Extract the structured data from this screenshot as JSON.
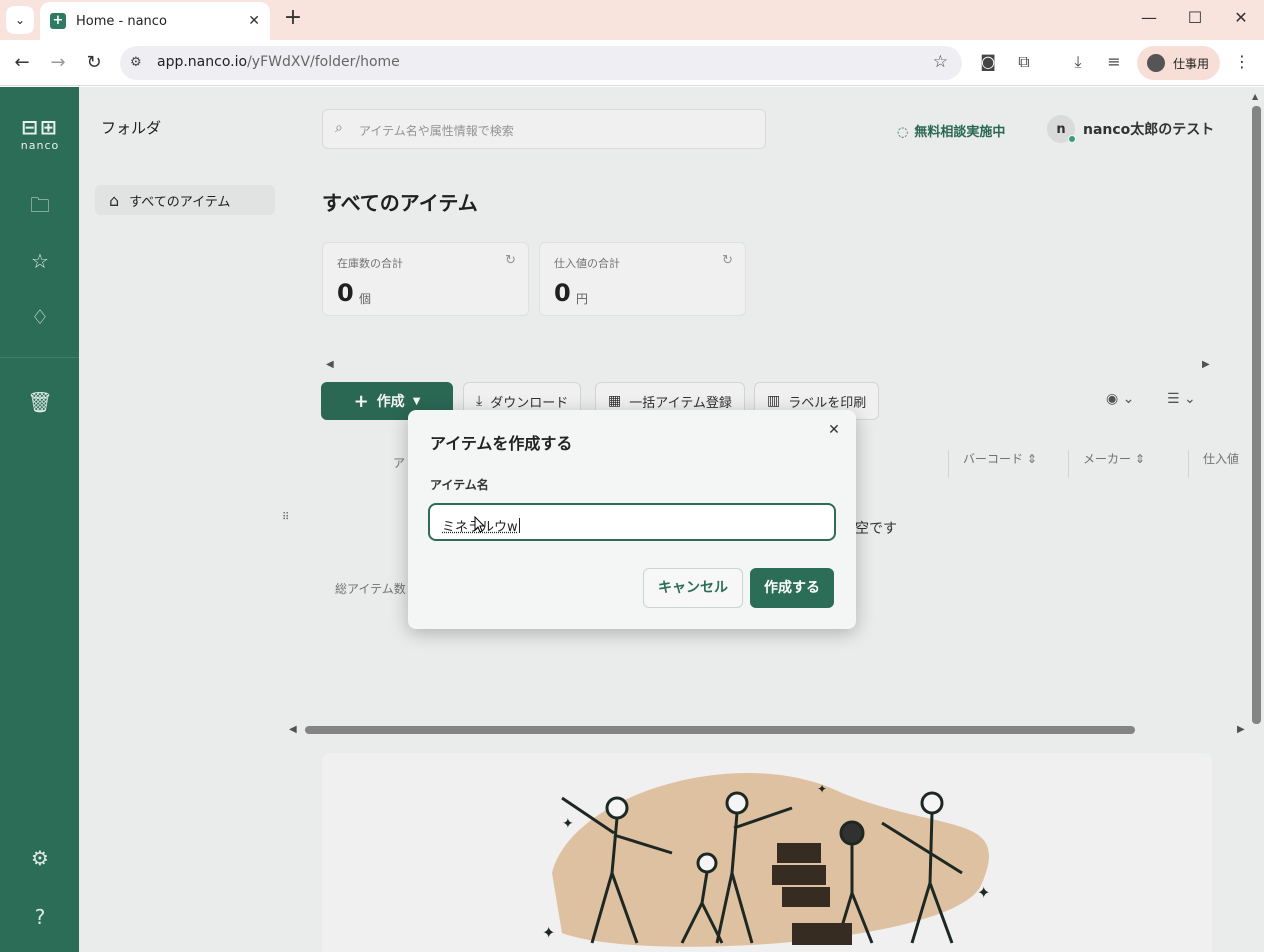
{
  "browser": {
    "tab_title": "Home - nanco",
    "url_host": "app.nanco.io",
    "url_path": "/yFWdXV/folder/home",
    "profile_label": "仕事用"
  },
  "sidebar": {
    "logo_text": "nanco"
  },
  "folder_panel": {
    "title": "フォルダ",
    "items": [
      {
        "label": "すべてのアイテム"
      }
    ]
  },
  "header": {
    "search_placeholder": "アイテム名や属性情報で検索",
    "consult_label": "無料相談実施中",
    "user_initial": "n",
    "user_name": "nanco太郎のテスト"
  },
  "main": {
    "title": "すべてのアイテム",
    "stats": [
      {
        "label": "在庫数の合計",
        "value": "0",
        "unit": "個"
      },
      {
        "label": "仕入値の合計",
        "value": "0",
        "unit": "円"
      }
    ],
    "toolbar": {
      "create_label": "作成",
      "download_label": "ダウンロード",
      "bulk_label": "一括アイテム登録",
      "print_label": "ラベルを印刷"
    },
    "table_headers": [
      "バーコード",
      "メーカー",
      "仕入値"
    ],
    "first_header_fragment": "ア",
    "empty_text": "空です",
    "total_label": "総アイテム数"
  },
  "modal": {
    "title": "アイテムを作成する",
    "field_label": "アイテム名",
    "field_value": "ミネラルウw",
    "cancel_label": "キャンセル",
    "submit_label": "作成する"
  },
  "colors": {
    "brand": "#2c6d58",
    "tabbar": "#f9e3dd"
  }
}
